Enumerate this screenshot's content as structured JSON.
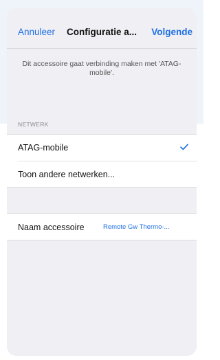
{
  "nav": {
    "cancel_label": "Annuleer",
    "title": "Configuratie a...",
    "next_label": "Volgende"
  },
  "info_text": "Dit accessoire gaat verbinding maken met 'ATAG-mobile'.",
  "network": {
    "section_header": "NETWERK",
    "items": [
      {
        "label": "ATAG-mobile",
        "selected": true,
        "icon": "checkmark-icon"
      },
      {
        "label": "Toon andere netwerken...",
        "selected": false
      }
    ]
  },
  "accessory": {
    "name_label": "Naam accessoire",
    "name_value": "Remote Gw Thermo-..."
  },
  "colors": {
    "accent": "#1f6fe5",
    "sheet_background": "#efeff4",
    "page_tint": "#eef4fa"
  }
}
